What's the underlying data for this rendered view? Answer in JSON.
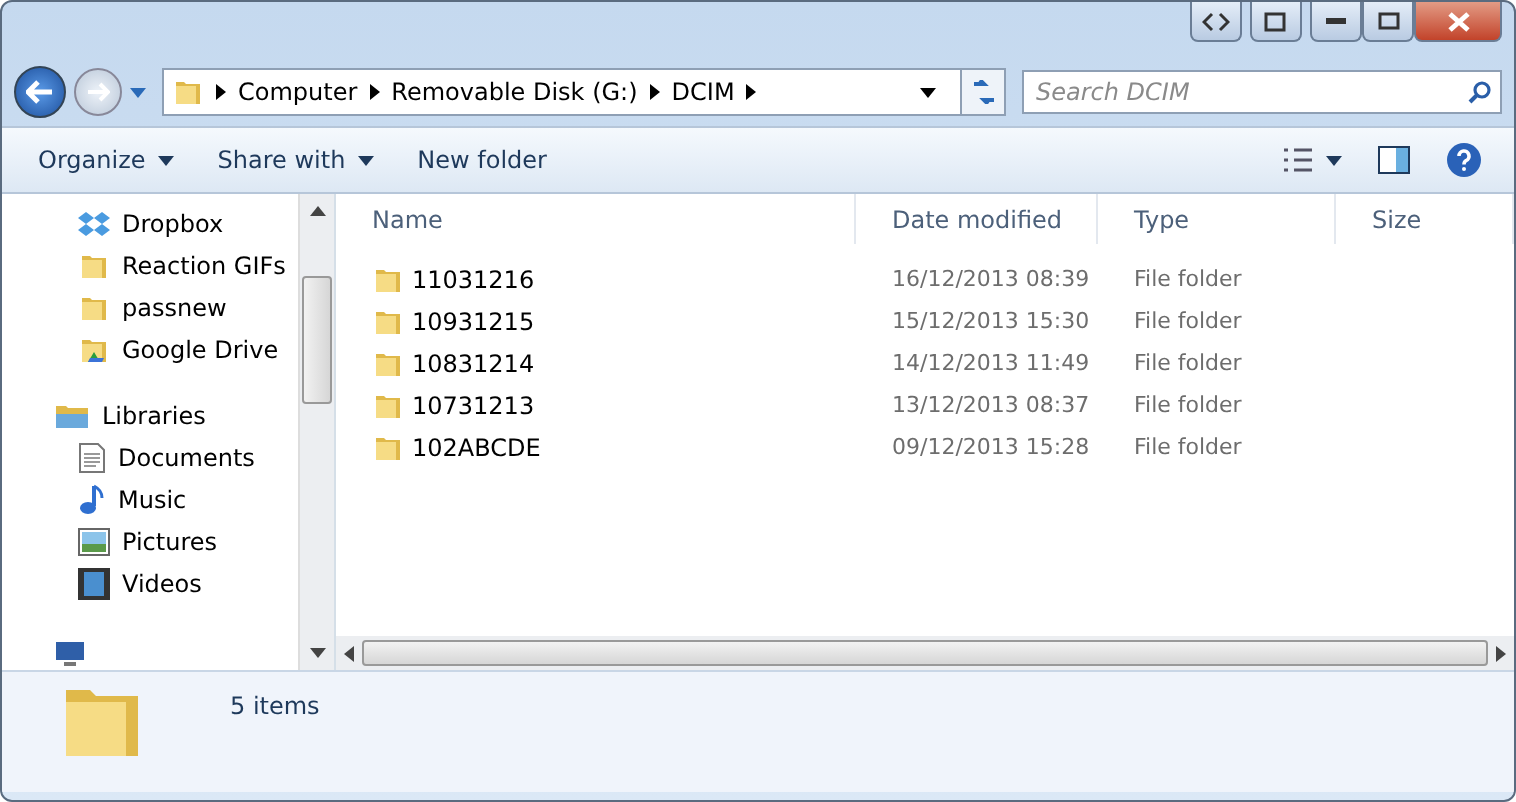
{
  "address_bar": {
    "segments": [
      "Computer",
      "Removable Disk (G:)",
      "DCIM"
    ]
  },
  "search": {
    "placeholder": "Search DCIM"
  },
  "toolbar": {
    "buttons": [
      {
        "label": "Organize",
        "dropdown": true
      },
      {
        "label": "Share with",
        "dropdown": true
      },
      {
        "label": "New folder",
        "dropdown": false
      }
    ]
  },
  "sidebar": {
    "items": [
      {
        "label": "Dropbox",
        "kind": "dropbox"
      },
      {
        "label": "Reaction GIFs",
        "kind": "folder"
      },
      {
        "label": "passnew",
        "kind": "folder"
      },
      {
        "label": "Google Drive",
        "kind": "drive"
      },
      {
        "label": "Libraries",
        "kind": "libraries",
        "children": [
          {
            "label": "Documents",
            "kind": "documents"
          },
          {
            "label": "Music",
            "kind": "music"
          },
          {
            "label": "Pictures",
            "kind": "pictures"
          },
          {
            "label": "Videos",
            "kind": "videos"
          }
        ]
      }
    ]
  },
  "table": {
    "columns": [
      "Name",
      "Date modified",
      "Type",
      "Size"
    ],
    "rows": [
      {
        "name": "11031216",
        "date": "16/12/2013 08:39",
        "type": "File folder"
      },
      {
        "name": "10931215",
        "date": "15/12/2013 15:30",
        "type": "File folder"
      },
      {
        "name": "10831214",
        "date": "14/12/2013 11:49",
        "type": "File folder"
      },
      {
        "name": "10731213",
        "date": "13/12/2013 08:37",
        "type": "File folder"
      },
      {
        "name": "102ABCDE",
        "date": "09/12/2013 15:28",
        "type": "File folder"
      }
    ]
  },
  "status_bar": {
    "text": "5 items"
  }
}
